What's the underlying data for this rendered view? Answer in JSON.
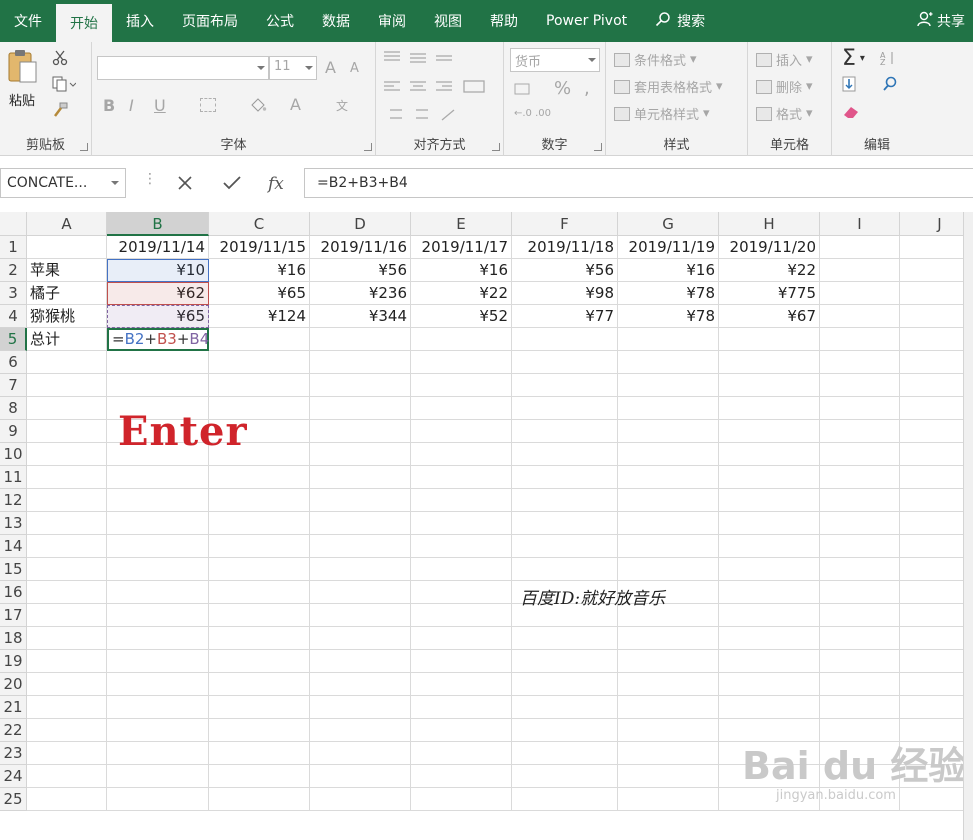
{
  "tabs": [
    "文件",
    "开始",
    "插入",
    "页面布局",
    "公式",
    "数据",
    "审阅",
    "视图",
    "帮助",
    "Power Pivot"
  ],
  "search_label": "搜索",
  "share_label": "共享",
  "ribbon": {
    "clipboard": {
      "paste": "粘贴",
      "label": "剪贴板"
    },
    "font": {
      "size": "11",
      "label": "字体",
      "grow": "A",
      "shrink": "A",
      "bold": "B",
      "italic": "I",
      "underline": "U",
      "color": "A",
      "wen": "文"
    },
    "align": {
      "label": "对齐方式"
    },
    "number": {
      "format": "货币",
      "percent": "%",
      "comma": ",",
      "label": "数字"
    },
    "styles": {
      "cond": "条件格式",
      "table": "套用表格格式",
      "cell": "单元格样式",
      "label": "样式"
    },
    "cells": {
      "insert": "插入",
      "delete": "删除",
      "format": "格式",
      "label": "单元格"
    },
    "edit": {
      "sum": "Σ",
      "label": "编辑"
    }
  },
  "formula_bar": {
    "name_box": "CONCATE...",
    "fx": "fx",
    "formula": "=B2+B3+B4"
  },
  "columns": [
    "A",
    "B",
    "C",
    "D",
    "E",
    "F",
    "G",
    "H",
    "I",
    "J"
  ],
  "rows": [
    "1",
    "2",
    "3",
    "4",
    "5",
    "6",
    "7",
    "8",
    "9",
    "10",
    "11",
    "12",
    "13",
    "14",
    "15",
    "16",
    "17",
    "18",
    "19",
    "20",
    "21",
    "22",
    "23",
    "24",
    "25"
  ],
  "sheet": {
    "dates": [
      "2019/11/14",
      "2019/11/15",
      "2019/11/16",
      "2019/11/17",
      "2019/11/18",
      "2019/11/19",
      "2019/11/20"
    ],
    "items": [
      {
        "name": "苹果",
        "values": [
          "¥10",
          "¥16",
          "¥56",
          "¥16",
          "¥56",
          "¥16",
          "¥22"
        ]
      },
      {
        "name": "橘子",
        "values": [
          "¥62",
          "¥65",
          "¥236",
          "¥22",
          "¥98",
          "¥78",
          "¥775"
        ]
      },
      {
        "name": "猕猴桃",
        "values": [
          "¥65",
          "¥124",
          "¥344",
          "¥52",
          "¥77",
          "¥78",
          "¥67"
        ]
      }
    ],
    "total_label": "总计",
    "edit_formula": {
      "eq": "=",
      "b2": "B2",
      "p1": "+",
      "b3": "B3",
      "p2": "+",
      "b4": "B4"
    }
  },
  "overlay_text": "Enter",
  "signature": "百度ID:就好放音乐",
  "watermark": "Bai du 经验",
  "watermark_url": "jingyan.baidu.com",
  "colors": {
    "accent": "#217346",
    "b2_ref": "#4472c4",
    "b3_ref": "#c0504d",
    "b4_ref": "#8064a2",
    "overlay": "#d0242b"
  }
}
